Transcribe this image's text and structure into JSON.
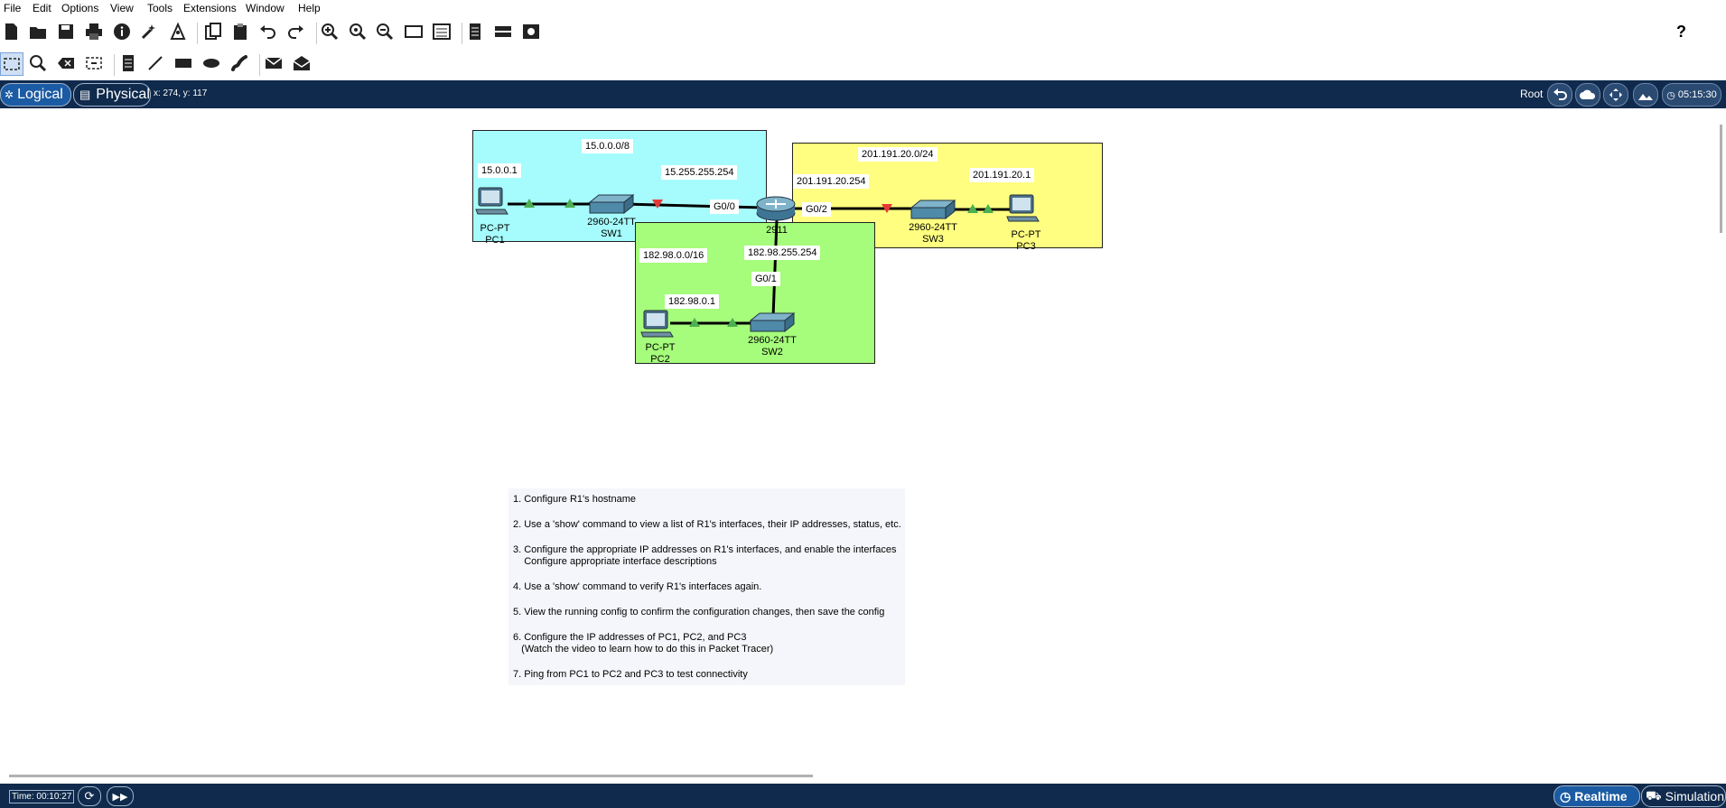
{
  "menu": [
    "File",
    "Edit",
    "Options",
    "View",
    "Tools",
    "Extensions",
    "Window",
    "Help"
  ],
  "toolbar_top": [
    "new-file-icon",
    "open-folder-icon",
    "save-icon",
    "print-icon",
    "info-icon",
    "wizard-icon",
    "network-icon",
    "copy-icon",
    "paste-icon",
    "undo-icon",
    "redo-icon",
    "zoom-in-icon",
    "zoom-reset-icon",
    "zoom-out-icon",
    "rectangle-view-icon",
    "palette-icon",
    "pdu-list-icon",
    "device-icon",
    "image-icon"
  ],
  "toolbar_bottom": [
    "select-icon",
    "inspect-icon",
    "delete-icon",
    "resize-icon",
    "note-icon",
    "line-icon",
    "rectangle-icon",
    "ellipse-icon",
    "freeform-icon",
    "simple-pdu-icon",
    "complex-pdu-icon"
  ],
  "help_glyph": "?",
  "nav": {
    "logical_label": "Logical",
    "physical_label": "Physical",
    "coords": "x: 274, y: 117",
    "root_label": "Root",
    "clock": "05:15:30"
  },
  "areas": [
    {
      "name": "network-area-sw1",
      "color": "#a6fcfd"
    },
    {
      "name": "network-area-sw3",
      "color": "#fffe80"
    },
    {
      "name": "network-area-sw2",
      "color": "#a6fc7b"
    }
  ],
  "labels": {
    "net1": "15.0.0.0/8",
    "pc1_ip": "15.0.0.1",
    "r1_g00_ip": "15.255.255.254",
    "g00": "G0/0",
    "net3": "201.191.20.0/24",
    "r1_g02_ip": "201.191.20.254",
    "g02": "G0/2",
    "pc3_ip": "201.191.20.1",
    "net2": "182.98.0.0/16",
    "r1_g01_ip": "182.98.255.254",
    "g01": "G0/1",
    "pc2_ip": "182.98.0.1"
  },
  "devices": {
    "pc1": {
      "type": "PC-PT",
      "name": "PC1"
    },
    "sw1": {
      "type": "2960-24TT",
      "name": "SW1"
    },
    "r1": {
      "type": "2911",
      "name": ""
    },
    "sw3": {
      "type": "2960-24TT",
      "name": "SW3"
    },
    "pc3": {
      "type": "PC-PT",
      "name": "PC3"
    },
    "sw2": {
      "type": "2960-24TT",
      "name": "SW2"
    },
    "pc2": {
      "type": "PC-PT",
      "name": "PC2"
    }
  },
  "instructions": [
    "1. Configure R1's hostname",
    "2. Use a 'show' command to view a list of R1's interfaces, their IP addresses, status, etc.",
    "3. Configure the appropriate IP addresses on R1's interfaces, and enable the interfaces",
    "    Configure appropriate interface descriptions",
    "4. Use a 'show' command to verify R1's interfaces again.",
    "5. View the running config to confirm the configuration changes, then save the config",
    "6. Configure the IP addresses of PC1, PC2, and PC3",
    "   (Watch the video to learn how to do this in Packet Tracer)",
    "7. Ping from PC1 to PC2 and PC3 to test connectivity"
  ],
  "status": {
    "time": "Time: 00:10:27",
    "realtime": "Realtime",
    "simulation": "Simulation"
  }
}
